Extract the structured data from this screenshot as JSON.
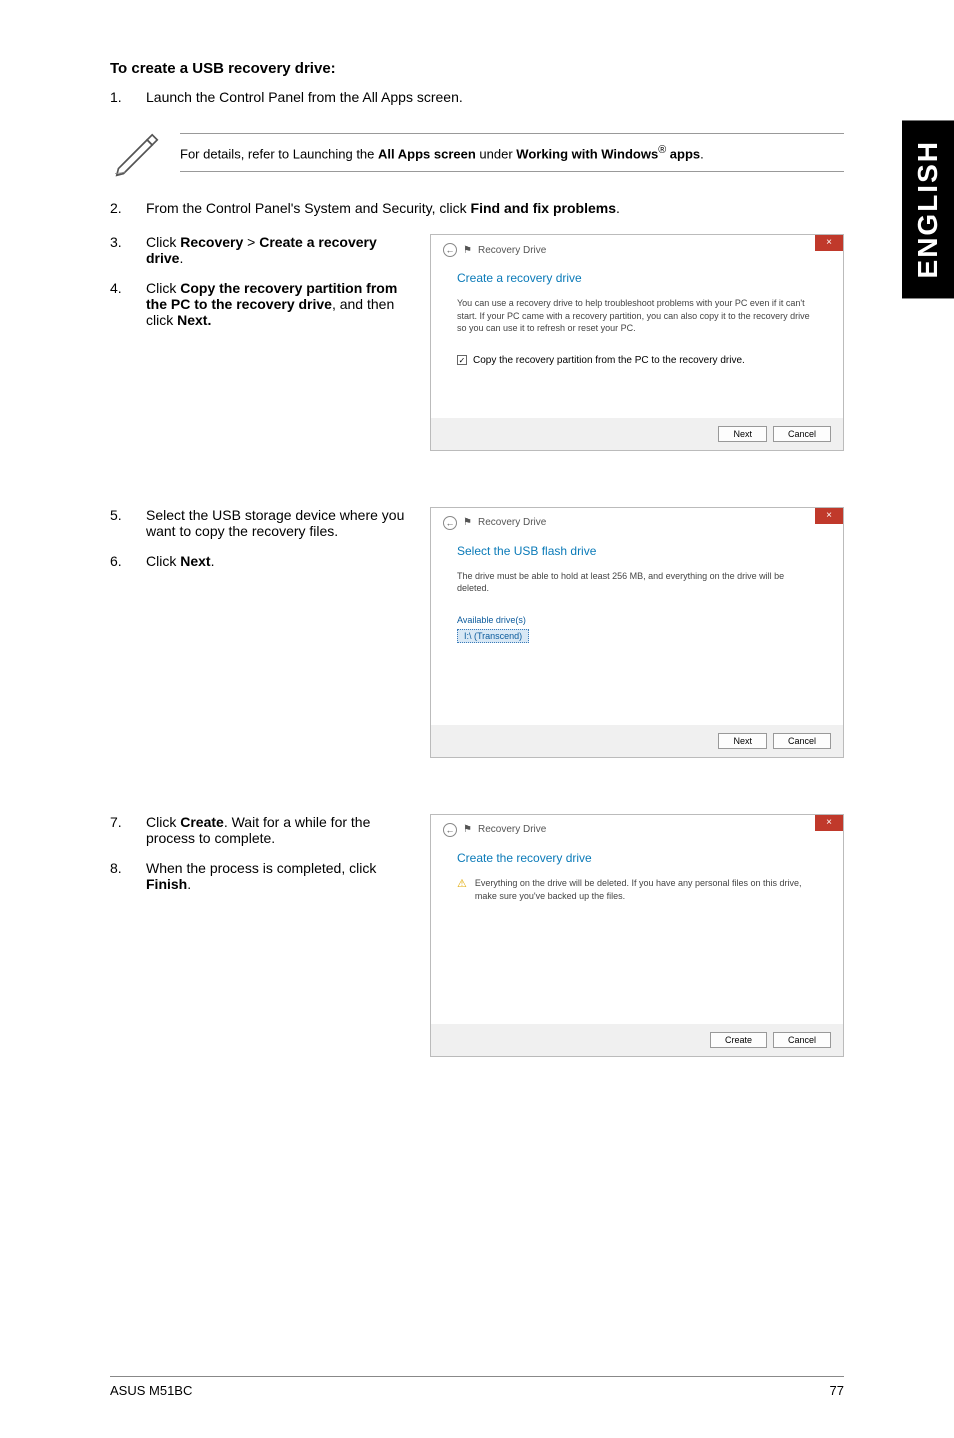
{
  "sidebar": {
    "label": "ENGLISH"
  },
  "section_title": "To create a USB recovery drive:",
  "step1": {
    "num": "1.",
    "text": "Launch the Control Panel from the All Apps screen."
  },
  "note": {
    "text_prefix": "For details, refer to Launching the ",
    "bold1": "All Apps screen",
    "mid": " under ",
    "bold2": "Working with Windows",
    "reg": "®",
    "bold3": " apps",
    "suffix": "."
  },
  "step2": {
    "num": "2.",
    "text_prefix": "From the Control Panel's System and Security, click ",
    "bold": "Find and fix problems",
    "suffix": "."
  },
  "step3": {
    "num": "3.",
    "prefix": "Click ",
    "b1": "Recovery",
    "gt": " > ",
    "b2": "Create a recovery drive",
    "suffix": "."
  },
  "step4": {
    "num": "4.",
    "prefix": "Click ",
    "b1": "Copy the recovery partition from the PC to the recovery drive",
    "mid": ", and then click ",
    "b2": "Next."
  },
  "step5": {
    "num": "5.",
    "text": "Select the USB storage device where you want to copy the recovery files."
  },
  "step6": {
    "num": "6.",
    "prefix": "Click ",
    "bold": "Next",
    "suffix": "."
  },
  "step7": {
    "num": "7.",
    "prefix": "Click ",
    "bold": "Create",
    "suffix": ". Wait for a while for the process to complete."
  },
  "step8": {
    "num": "8.",
    "prefix": "When the process is completed, click ",
    "bold": "Finish",
    "suffix": "."
  },
  "dialog1": {
    "crumb": "Recovery Drive",
    "title": "Create a recovery drive",
    "text": "You can use a recovery drive to help troubleshoot problems with your PC even if it can't start. If your PC came with a recovery partition, you can also copy it to the recovery drive so you can use it to refresh or reset your PC.",
    "checkbox": "Copy the recovery partition from the PC to the recovery drive.",
    "next": "Next",
    "cancel": "Cancel"
  },
  "dialog2": {
    "crumb": "Recovery Drive",
    "title": "Select the USB flash drive",
    "text": "The drive must be able to hold at least 256 MB, and everything on the drive will be deleted.",
    "label": "Available drive(s)",
    "drive": "I:\\ (Transcend)",
    "next": "Next",
    "cancel": "Cancel"
  },
  "dialog3": {
    "crumb": "Recovery Drive",
    "title": "Create the recovery drive",
    "warn": "Everything on the drive will be deleted. If you have any personal files on this drive, make sure you've backed up the files.",
    "create": "Create",
    "cancel": "Cancel"
  },
  "footer": {
    "left": "ASUS M51BC",
    "right": "77"
  }
}
